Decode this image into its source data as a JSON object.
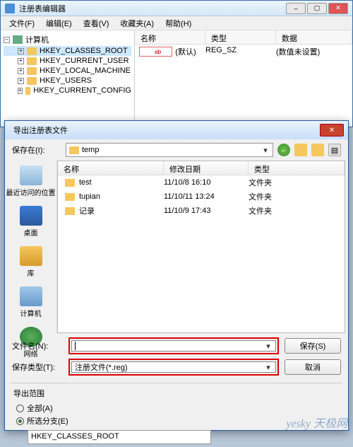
{
  "reg": {
    "title": "注册表编辑器",
    "menu": {
      "file": "文件(F)",
      "edit": "编辑(E)",
      "view": "查看(V)",
      "fav": "收藏夹(A)",
      "help": "帮助(H)"
    },
    "tree_root": "计算机",
    "keys": [
      "HKEY_CLASSES_ROOT",
      "HKEY_CURRENT_USER",
      "HKEY_LOCAL_MACHINE",
      "HKEY_USERS",
      "HKEY_CURRENT_CONFIG"
    ],
    "cols": {
      "name": "名称",
      "type": "类型",
      "data": "数据"
    },
    "row": {
      "name": "(默认)",
      "type": "REG_SZ",
      "data": "(数值未设置)"
    }
  },
  "dlg": {
    "title": "导出注册表文件",
    "save_in": "保存在(I):",
    "folder": "temp",
    "cols": {
      "name": "名称",
      "mdate": "修改日期",
      "type": "类型"
    },
    "rows": [
      {
        "name": "test",
        "mdate": "11/10/8 16:10",
        "type": "文件夹"
      },
      {
        "name": "tupian",
        "mdate": "11/10/11 13:24",
        "type": "文件夹"
      },
      {
        "name": "记录",
        "mdate": "11/10/9 17:43",
        "type": "文件夹"
      }
    ],
    "places": {
      "recent": "最近访问的位置",
      "desktop": "桌面",
      "library": "库",
      "computer": "计算机",
      "network": "网络"
    },
    "fname_label": "文件名(N):",
    "ftype_label": "保存类型(T):",
    "ftype_value": "注册文件(*.reg)",
    "save_btn": "保存(S)",
    "cancel_btn": "取消",
    "scope_title": "导出范围",
    "scope_all": "全部(A)",
    "scope_branch": "所选分支(E)",
    "branch_value": "HKEY_CLASSES_ROOT"
  },
  "watermark": "yesky 天极网"
}
